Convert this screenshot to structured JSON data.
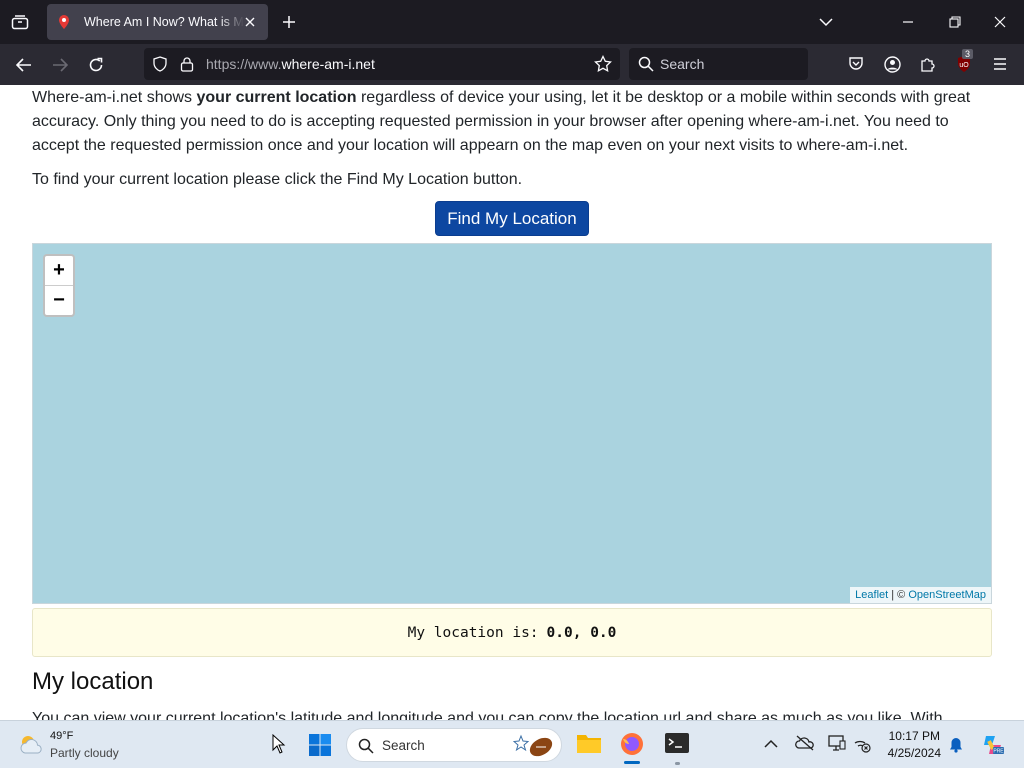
{
  "browser": {
    "tab_title": "Where Am I Now? What is My Location",
    "url_prefix": "https://www.",
    "url_domain": "where-am-i.net",
    "search_placeholder": "Search",
    "extension_badge": "3"
  },
  "page": {
    "intro_part1": "Where-am-i.net shows ",
    "intro_bold": "your current location",
    "intro_part2": " regardless of device your using, let it be desktop or a mobile within seconds with great accuracy. Only thing you need to do is accepting requested permission in your browser after opening where-am-i.net. You need to accept the requested permission once and your location will appearn on the map even on your next visits to where-am-i.net.",
    "instruction": "To find your current location please click the Find My Location button.",
    "find_button": "Find My Location",
    "map": {
      "zoom_in": "+",
      "zoom_out": "−",
      "attribution_leaflet": "Leaflet",
      "attribution_sep": " | © ",
      "attribution_osm": "OpenStreetMap"
    },
    "location_label": "My location is:",
    "location_value": "0.0, 0.0",
    "heading": "My location",
    "paragraph3": "You can view your current location's latitude and longitude and you can copy the location url and share as much as you like. With"
  },
  "taskbar": {
    "weather_temp": "49°F",
    "weather_desc": "Partly cloudy",
    "search_label": "Search",
    "time": "10:17 PM",
    "date": "4/25/2024"
  },
  "colors": {
    "map_water": "#aad3df",
    "button_blue": "#0d47a1",
    "location_box": "#fffde7"
  }
}
